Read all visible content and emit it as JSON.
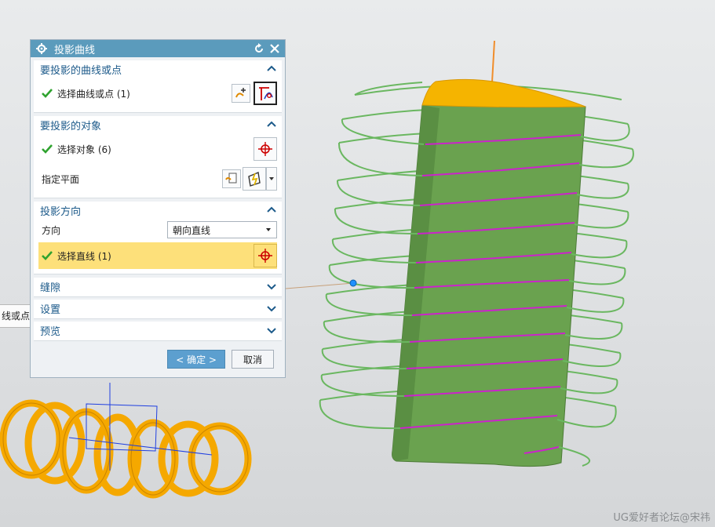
{
  "dialog": {
    "title": "投影曲线",
    "sections": {
      "curves": {
        "header": "要投影的曲线或点",
        "select_label": "选择曲线或点 (1)"
      },
      "objects": {
        "header": "要投影的对象",
        "select_label": "选择对象 (6)",
        "plane_label": "指定平面"
      },
      "direction": {
        "header": "投影方向",
        "direction_label": "方向",
        "direction_value": "朝向直线",
        "line_label": "选择直线 (1)"
      },
      "gap": {
        "header": "缝隙"
      },
      "settings": {
        "header": "设置"
      },
      "preview": {
        "header": "预览"
      }
    },
    "buttons": {
      "ok": "< 确定 >",
      "cancel": "取消"
    }
  },
  "tooltip": "线或点",
  "watermark": "UG爱好者论坛@宋祎",
  "colors": {
    "titlebar": "#5b9bbc",
    "highlight": "#fde07a",
    "solid_green": "#6aa24f",
    "top_face": "#f5b400",
    "helix_green": "#6ab760",
    "projected_curve": "#cc22cc",
    "spring_orange": "#f5a800"
  }
}
